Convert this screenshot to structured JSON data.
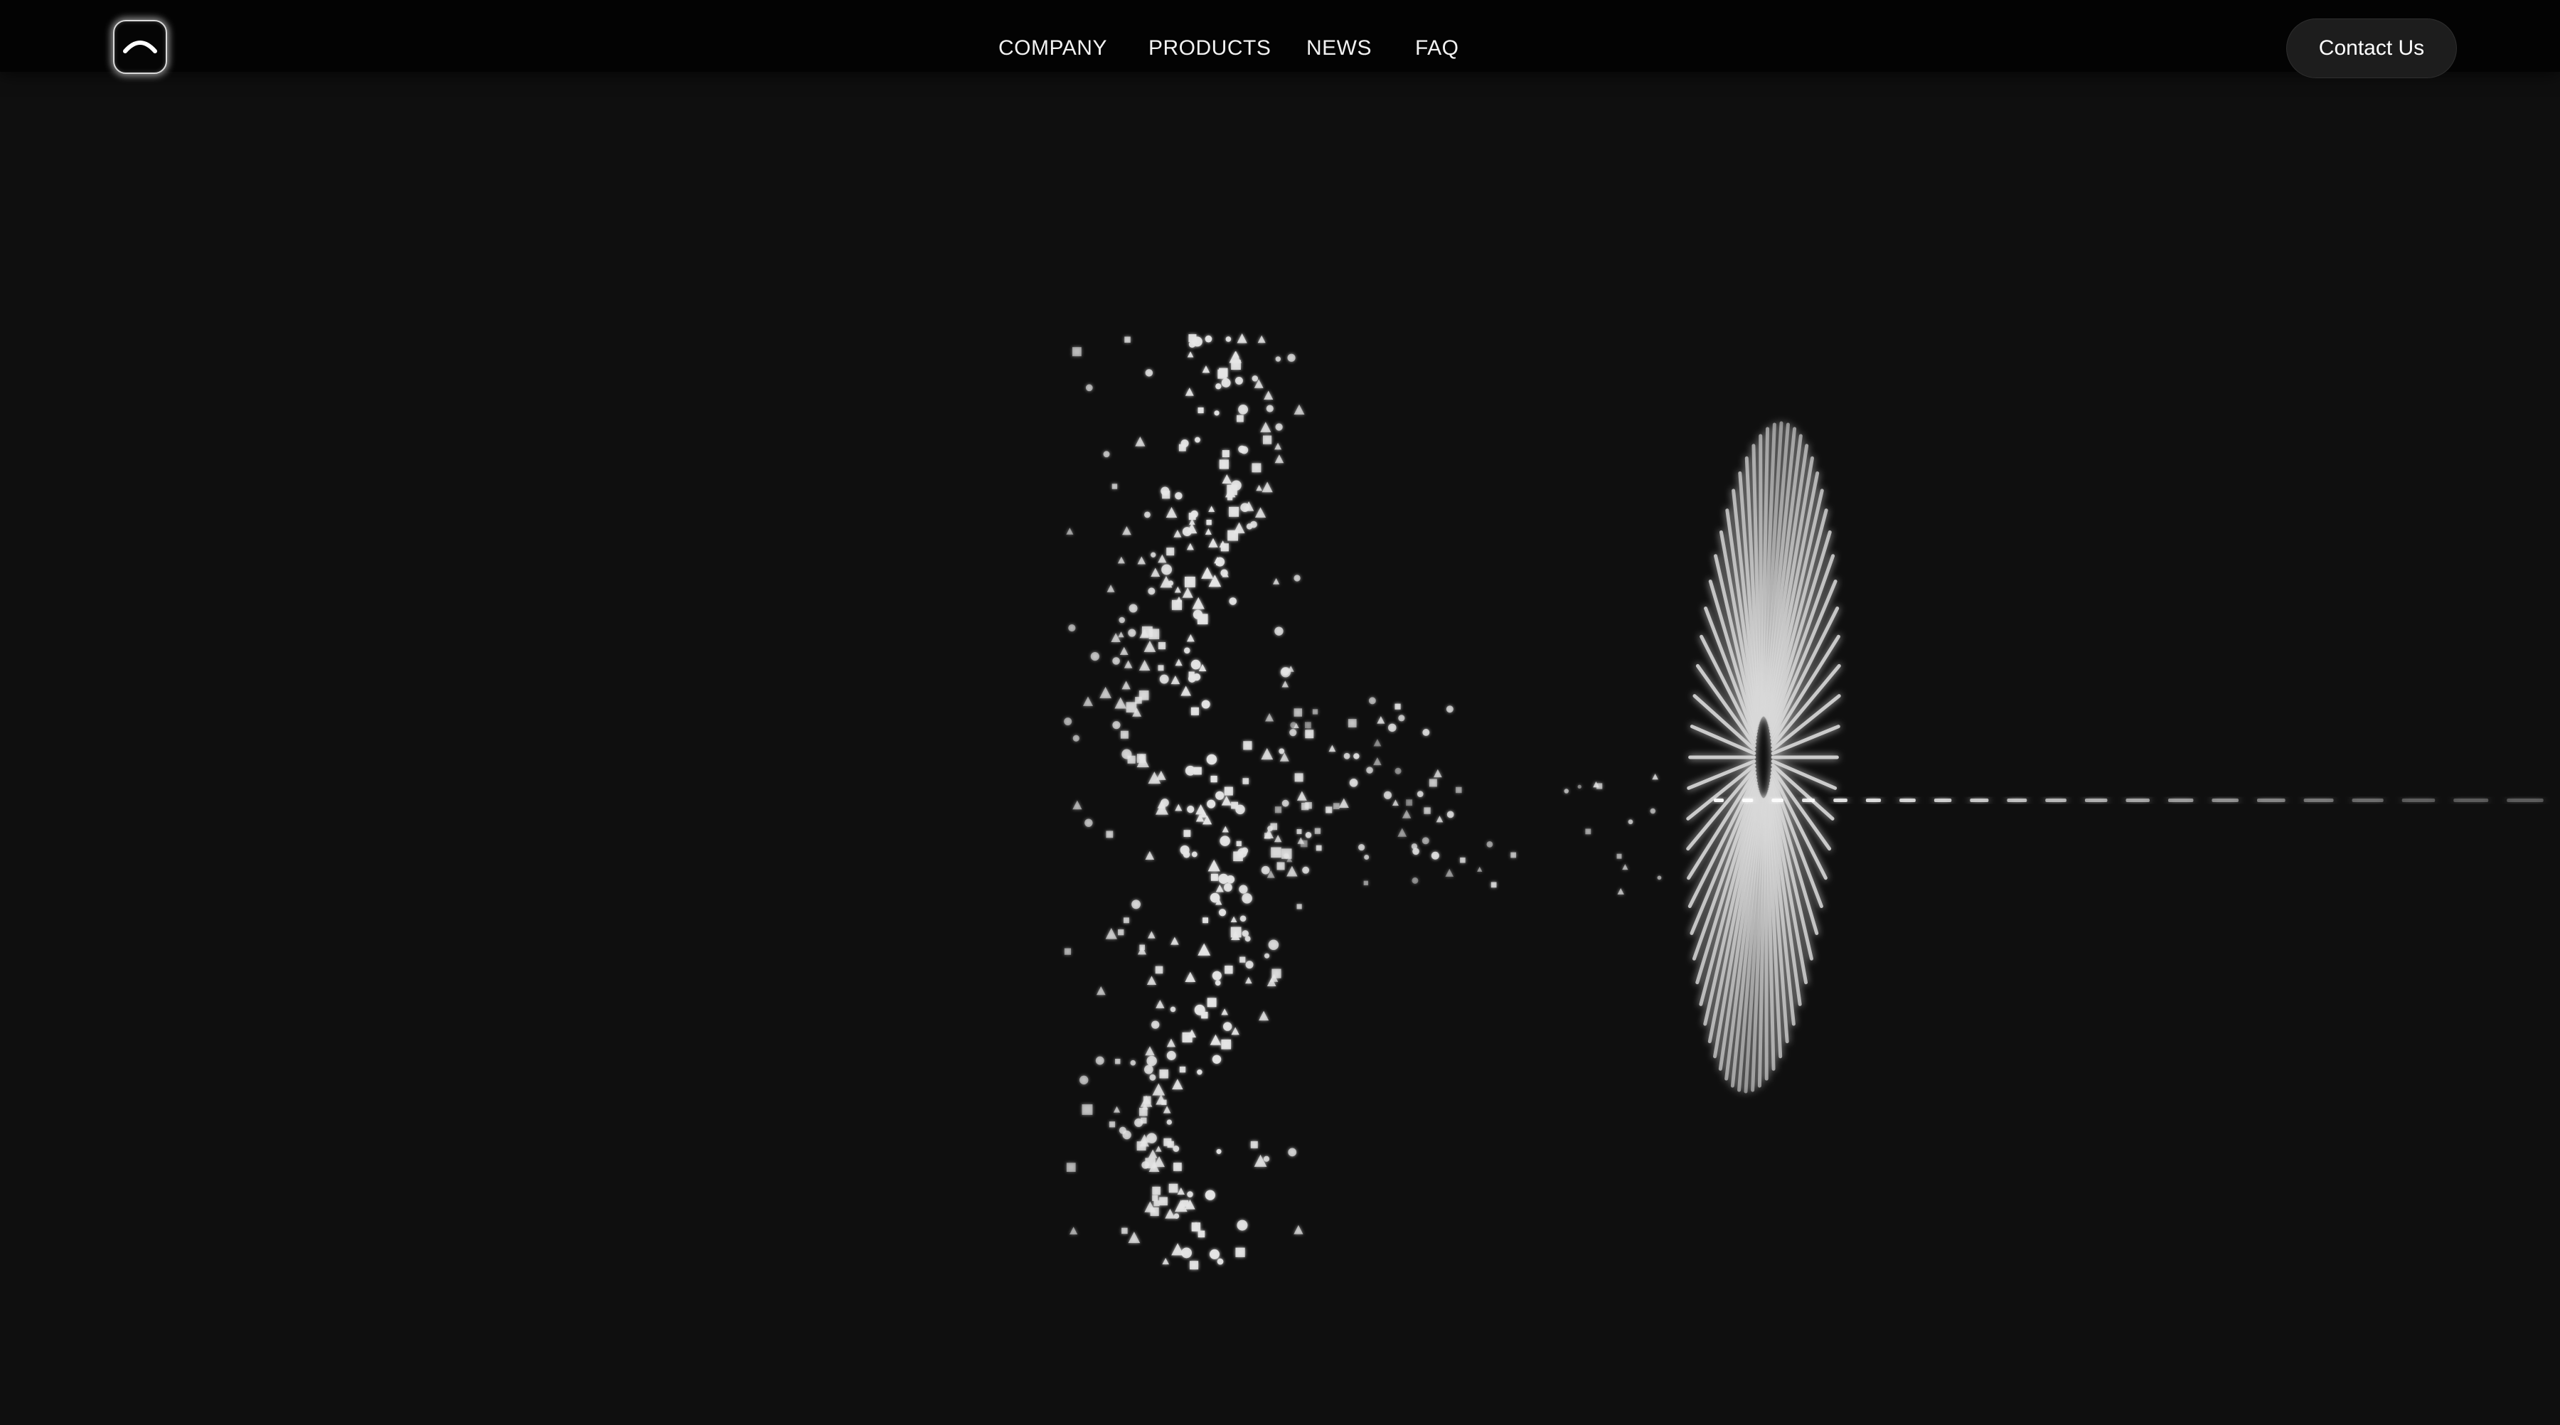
{
  "nav": {
    "logo_icon": "arc-logo-icon",
    "links": [
      {
        "label": "COMPANY"
      },
      {
        "label": "PRODUCTS"
      },
      {
        "label": "NEWS"
      },
      {
        "label": "FAQ"
      }
    ],
    "contact_label": "Contact Us"
  },
  "hero": {
    "visual": "particle-wave-animation"
  },
  "colors": {
    "background": "#0f0f0f",
    "navbar": "#030303",
    "text": "#ffffff",
    "button": "#1d1d1d",
    "particles": "#e6e6e6"
  }
}
